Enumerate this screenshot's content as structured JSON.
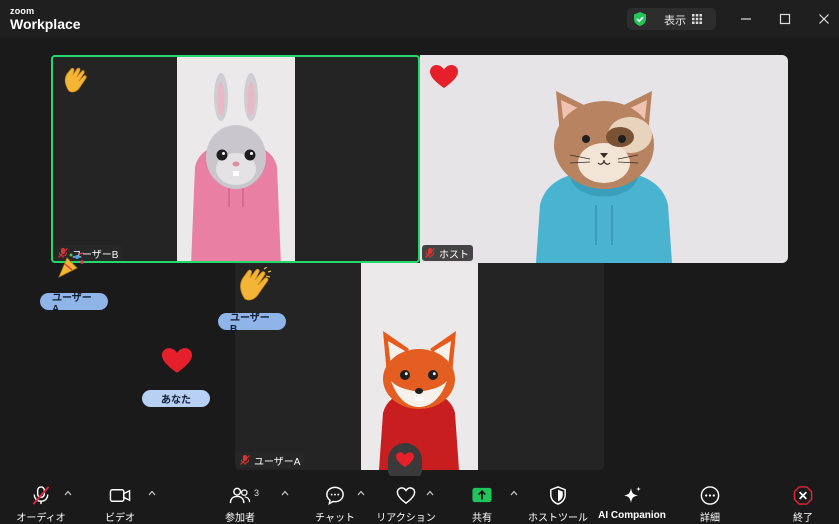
{
  "app": {
    "logo_small": "zoom",
    "logo_large": "Workplace"
  },
  "header": {
    "view_label": "表示"
  },
  "participants": {
    "user_b_tile": "ユーザーB",
    "host_tile": "ホスト",
    "user_a_tile": "ユーザーA"
  },
  "reactions": {
    "bubble_user_a": "ユーザーA",
    "bubble_user_b": "ユーザーB",
    "bubble_you": "あなた"
  },
  "toolbar": {
    "audio": "オーディオ",
    "video": "ビデオ",
    "participants": "参加者",
    "participants_count": "3",
    "chat": "チャット",
    "reactions": "リアクション",
    "share": "共有",
    "host_tools": "ホストツール",
    "ai": "AI Companion",
    "more": "詳細",
    "end": "終了"
  },
  "colors": {
    "accent_green": "#23d96b",
    "share_green": "#21c45a",
    "end_red": "#e0233f",
    "bubble_blue": "#8fb4e8"
  }
}
